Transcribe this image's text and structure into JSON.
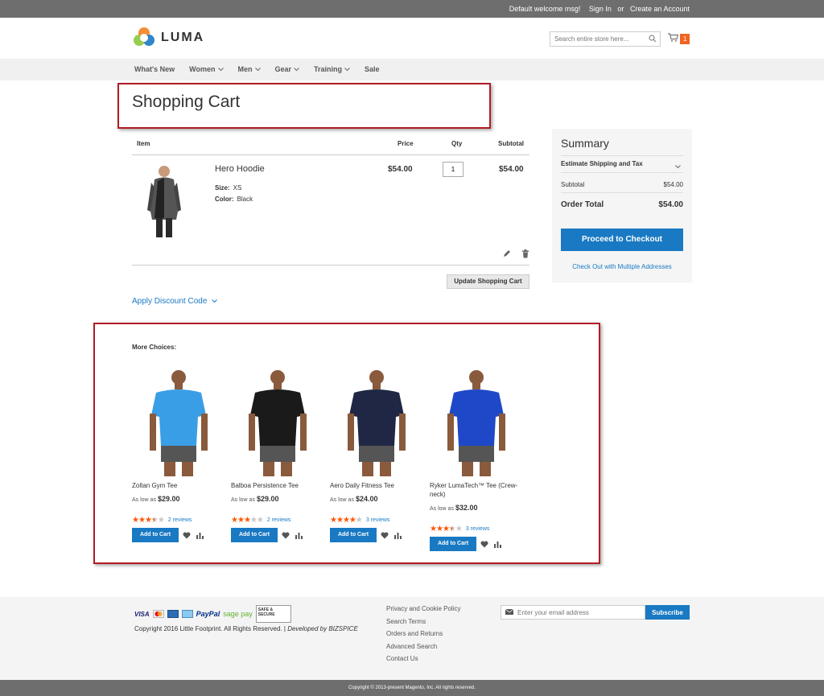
{
  "topbar": {
    "welcome": "Default welcome msg!",
    "sign_in": "Sign In",
    "or": "or",
    "create_account": "Create an Account"
  },
  "header": {
    "logo_text": "LUMA",
    "search_placeholder": "Search entire store here...",
    "cart_count": "1"
  },
  "nav": {
    "items": [
      "What's New",
      "Women",
      "Men",
      "Gear",
      "Training",
      "Sale"
    ]
  },
  "page_title": "Shopping Cart",
  "cart": {
    "headers": {
      "item": "Item",
      "price": "Price",
      "qty": "Qty",
      "subtotal": "Subtotal"
    },
    "items": [
      {
        "name": "Hero Hoodie",
        "size_label": "Size:",
        "size": "XS",
        "color_label": "Color:",
        "color": "Black",
        "price": "$54.00",
        "qty": "1",
        "subtotal": "$54.00"
      }
    ],
    "update_label": "Update Shopping Cart",
    "discount_label": "Apply Discount Code"
  },
  "summary": {
    "title": "Summary",
    "estimate_label": "Estimate Shipping and Tax",
    "subtotal_label": "Subtotal",
    "subtotal_value": "$54.00",
    "order_total_label": "Order Total",
    "order_total_value": "$54.00",
    "checkout_label": "Proceed to Checkout",
    "multi_label": "Check Out with Multiple Addresses"
  },
  "more_choices": {
    "title": "More Choices:",
    "products": [
      {
        "name": "Zoltan Gym Tee",
        "price_prefix": "As low as",
        "price": "$29.00",
        "rating": 3.5,
        "reviews": "2 reviews",
        "add_label": "Add to Cart",
        "shirt_color": "#3a9ee6"
      },
      {
        "name": "Balboa Persistence Tee",
        "price_prefix": "As low as",
        "price": "$29.00",
        "rating": 3,
        "reviews": "2 reviews",
        "add_label": "Add to Cart",
        "shirt_color": "#1a1a1a"
      },
      {
        "name": "Aero Daily Fitness Tee",
        "price_prefix": "As low as",
        "price": "$24.00",
        "rating": 4,
        "reviews": "3 reviews",
        "add_label": "Add to Cart",
        "shirt_color": "#1f2744"
      },
      {
        "name": "Ryker LumaTech™ Tee (Crew-neck)",
        "price_prefix": "As low as",
        "price": "$32.00",
        "rating": 3.5,
        "reviews": "3 reviews",
        "add_label": "Add to Cart",
        "shirt_color": "#1f48c8"
      }
    ]
  },
  "footer": {
    "payment_logos": [
      "VISA",
      "MC",
      "AMEX",
      "PayPal",
      "sage pay",
      "SAFE & SECURE"
    ],
    "copyright_left": "Copyright 2016 Little Footprint. All Rights Reserved. |",
    "developed_by": "Developed by BIZSPICE",
    "links": [
      "Privacy and Cookie Policy",
      "Search Terms",
      "Orders and Returns",
      "Advanced Search",
      "Contact Us"
    ],
    "newsletter_placeholder": "Enter your email address",
    "subscribe_label": "Subscribe",
    "bottom_copyright": "Copyright © 2013-present Magento, Inc. All rights reserved."
  },
  "colors": {
    "accent": "#1979c3",
    "brand_orange": "#f26322",
    "highlight_box": "#b01c24",
    "star": "#ff5501"
  }
}
